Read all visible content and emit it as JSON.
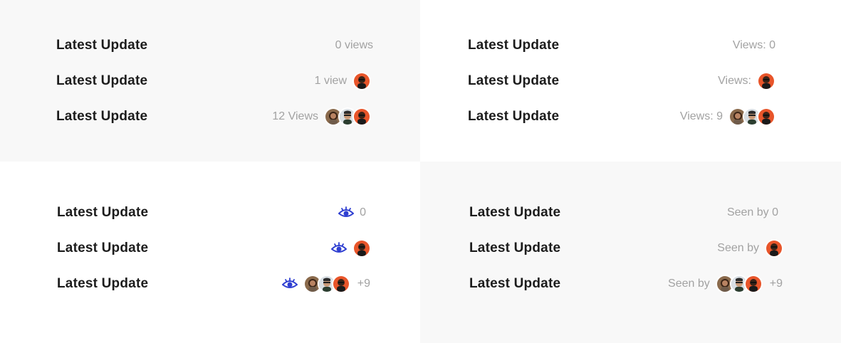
{
  "q1": {
    "rows": [
      {
        "title": "Latest Update",
        "meta": "0 views"
      },
      {
        "title": "Latest Update",
        "meta": "1 view"
      },
      {
        "title": "Latest Update",
        "meta": "12 Views"
      }
    ]
  },
  "q2": {
    "rows": [
      {
        "title": "Latest Update",
        "meta": "Views: 0"
      },
      {
        "title": "Latest Update",
        "meta": "Views:"
      },
      {
        "title": "Latest Update",
        "meta": "Views: 9"
      }
    ]
  },
  "q3": {
    "rows": [
      {
        "title": "Latest Update",
        "count": "0"
      },
      {
        "title": "Latest Update"
      },
      {
        "title": "Latest Update",
        "extra": "+9"
      }
    ]
  },
  "q4": {
    "rows": [
      {
        "title": "Latest Update",
        "meta": "Seen by 0"
      },
      {
        "title": "Latest Update",
        "meta": "Seen by"
      },
      {
        "title": "Latest Update",
        "meta": "Seen by",
        "extra": "+9"
      }
    ]
  },
  "colors": {
    "accent_eye": "#2f3fd1",
    "title": "#1c1c1c",
    "meta": "#a2a2a2",
    "panel_gray": "#f8f8f8"
  },
  "icons": {
    "eye": "eye-icon",
    "avatar": "user-avatar"
  }
}
